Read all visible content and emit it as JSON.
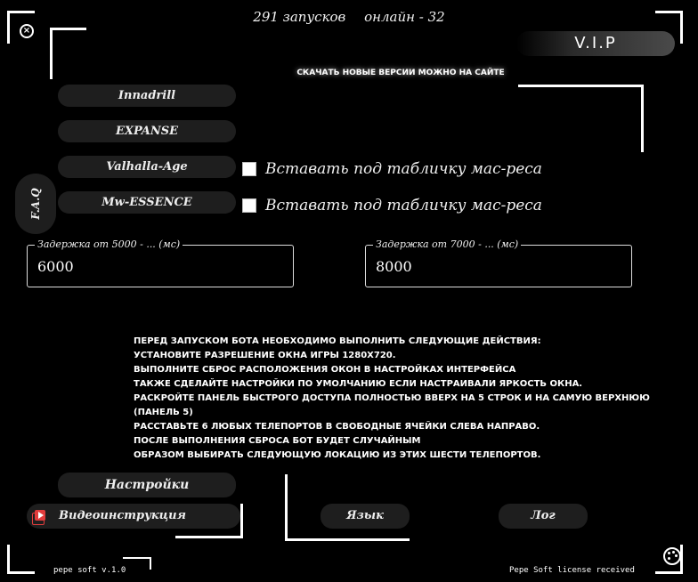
{
  "header": {
    "launches": "291 запусков",
    "online": "онлайн - 32"
  },
  "icons": {
    "close": "close-icon",
    "palette": "palette-icon",
    "video": "video-icon"
  },
  "vip_label": "V.I.P",
  "site_note": "СКАЧАТЬ НОВЫЕ ВЕРСИИ МОЖНО НА САЙТЕ",
  "servers": [
    {
      "label": "Innadrill"
    },
    {
      "label": "EXPANSE"
    },
    {
      "label": "Valhalla-Age"
    },
    {
      "label": "Mw-ESSENCE"
    }
  ],
  "checkboxes": [
    {
      "label": "Вставать под табличку мас-реса",
      "checked": false
    },
    {
      "label": "Вставать под табличку мас-реса",
      "checked": false
    }
  ],
  "faq_label": "F.A.Q",
  "delays": [
    {
      "label": "Задержка от 5000 - ... (мс)",
      "value": "6000"
    },
    {
      "label": "Задержка от 7000 - ... (мс)",
      "value": "8000"
    }
  ],
  "instructions": [
    "ПЕРЕД ЗАПУСКОМ БОТА НЕОБХОДИМО ВЫПОЛНИТЬ СЛЕДУЮЩИЕ ДЕЙСТВИЯ:",
    "УСТАНОВИТЕ РАЗРЕШЕНИЕ ОКНА ИГРЫ 1280Х720.",
    "ВЫПОЛНИТЕ СБРОС РАСПОЛОЖЕНИЯ ОКОН В НАСТРОЙКАХ ИНТЕРФЕЙСА",
    "ТАКЖЕ СДЕЛАЙТЕ НАСТРОЙКИ ПО УМОЛЧАНИЮ ЕСЛИ НАСТРАИВАЛИ ЯРКОСТЬ ОКНА.",
    "РАСКРОЙТЕ ПАНЕЛЬ БЫСТРОГО ДОСТУПА ПОЛНОСТЬЮ ВВЕРХ НА 5 СТРОК И НА САМУЮ ВЕРХНЮЮ (ПАНЕЛЬ 5)",
    "РАССТАВЬТЕ 6 ЛЮБЫХ ТЕЛЕПОРТОВ В СВОБОДНЫЕ ЯЧЕЙКИ СЛЕВА НАПРАВО.",
    "ПОСЛЕ ВЫПОЛНЕНИЯ СБРОСА БОТ БУДЕТ СЛУЧАЙНЫМ",
    "ОБРАЗОМ ВЫБИРАТЬ СЛЕДУЮЩУЮ ЛОКАЦИЮ ИЗ ЭТИХ ШЕСТИ ТЕЛЕПОРТОВ."
  ],
  "buttons": {
    "settings": "Настройки",
    "video": "Видеоинструкция",
    "language": "Язык",
    "log": "Лог"
  },
  "footer": {
    "version": "pepe soft v.1.0",
    "license": "Pepe Soft license received"
  },
  "colors": {
    "background": "#000000",
    "pill": "#1e1e1e",
    "video_icon": "#e23c3c"
  }
}
